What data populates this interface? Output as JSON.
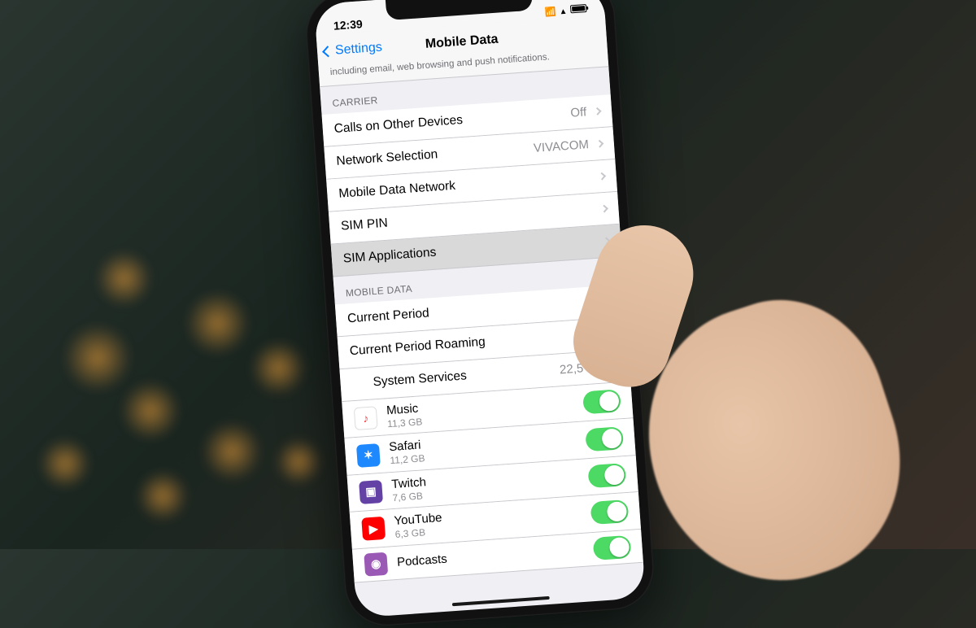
{
  "status": {
    "time": "12:39"
  },
  "nav": {
    "back_label": "Settings",
    "title": "Mobile Data",
    "description": "including email, web browsing and push notifications."
  },
  "carrier": {
    "header": "CARRIER",
    "rows": {
      "calls_on_other": {
        "label": "Calls on Other Devices",
        "value": "Off"
      },
      "network_selection": {
        "label": "Network Selection",
        "value": "VIVACOM"
      },
      "mobile_data_network": {
        "label": "Mobile Data Network"
      },
      "sim_pin": {
        "label": "SIM PIN"
      },
      "sim_applications": {
        "label": "SIM Applications"
      }
    }
  },
  "mobile_data": {
    "header": "MOBILE DATA",
    "current_period": {
      "label": "Current Period"
    },
    "current_period_roaming": {
      "label": "Current Period Roaming"
    },
    "system_services": {
      "label": "System Services",
      "value": "22,5 GB"
    },
    "apps": [
      {
        "name": "Music",
        "usage": "11,3 GB",
        "icon_bg": "#ffffff",
        "icon_glyph": "♪",
        "icon_color": "#fc3c44"
      },
      {
        "name": "Safari",
        "usage": "11,2 GB",
        "icon_bg": "#1e88ff",
        "icon_glyph": "✶",
        "icon_color": "#ffffff"
      },
      {
        "name": "Twitch",
        "usage": "7,6 GB",
        "icon_bg": "#6441a5",
        "icon_glyph": "▣",
        "icon_color": "#ffffff"
      },
      {
        "name": "YouTube",
        "usage": "6,3 GB",
        "icon_bg": "#ff0000",
        "icon_glyph": "▶",
        "icon_color": "#ffffff"
      },
      {
        "name": "Podcasts",
        "usage": "",
        "icon_bg": "#9b59b6",
        "icon_glyph": "◉",
        "icon_color": "#ffffff"
      }
    ]
  }
}
